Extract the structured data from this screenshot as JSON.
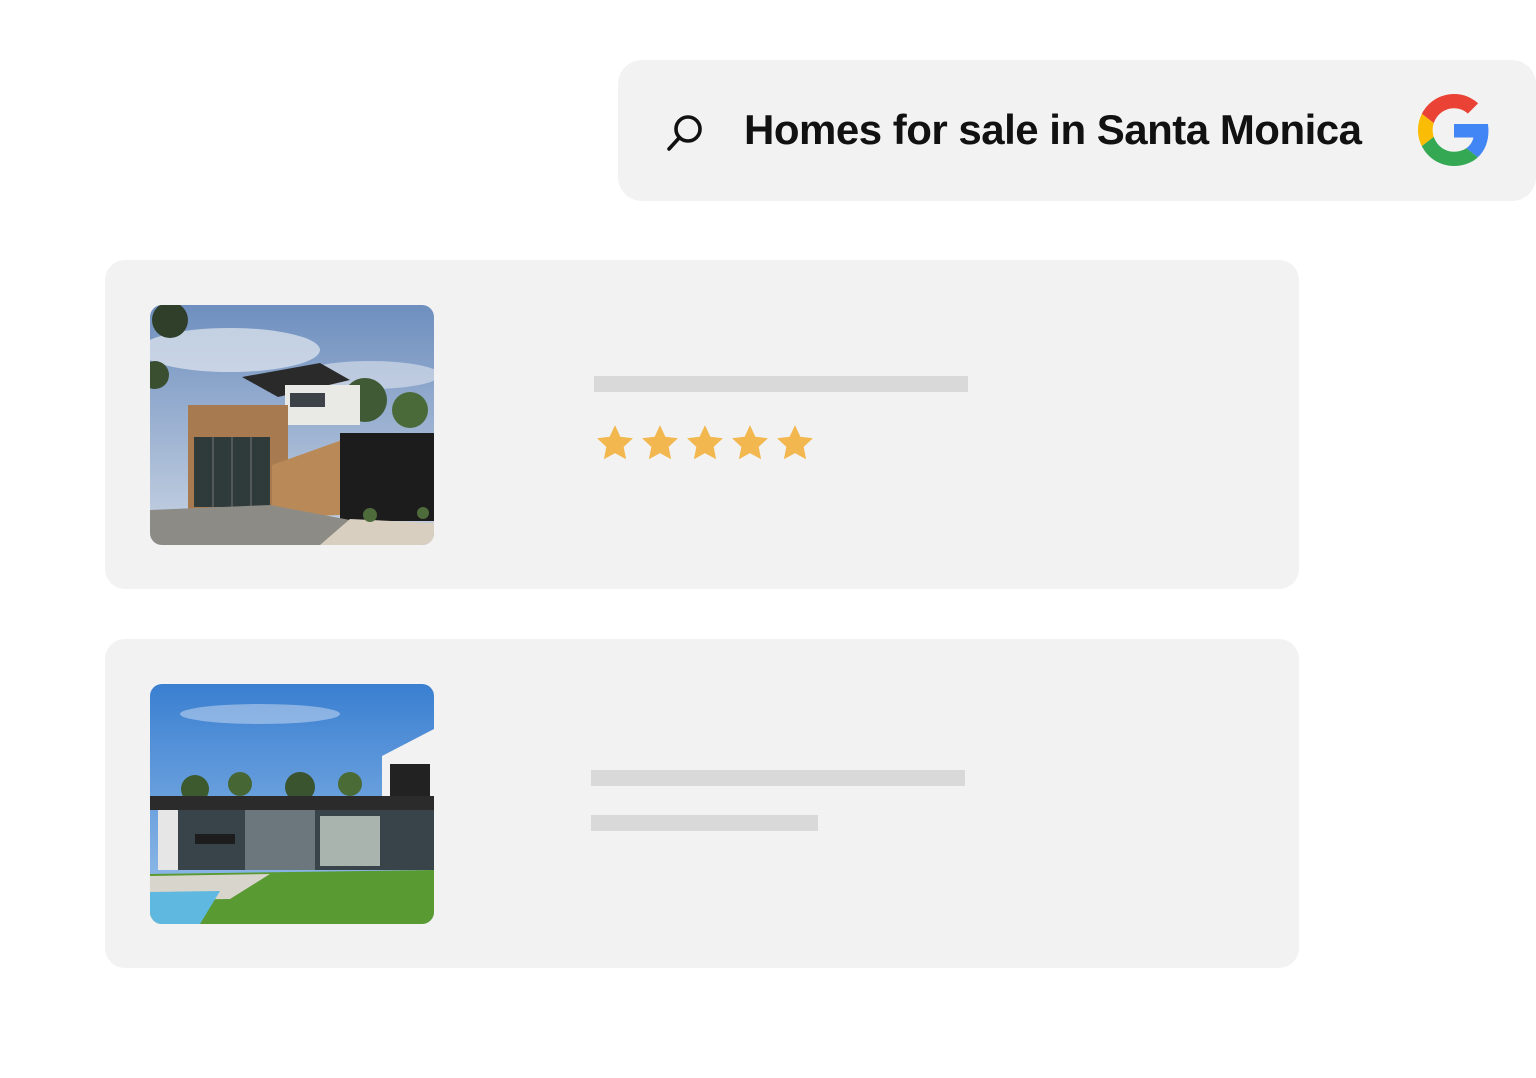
{
  "search": {
    "query": "Homes for sale in Santa Monica",
    "icon": "search-icon",
    "brand_icon": "google-logo"
  },
  "results": [
    {
      "image": "modern-house-timber-facade-photo",
      "rating": 5,
      "rating_max": 5
    },
    {
      "image": "modern-house-pool-lawn-photo"
    }
  ],
  "colors": {
    "card_background": "#f2f2f2",
    "skeleton": "#d9d9d9",
    "star": "#f2b74e",
    "google_blue": "#4285F4",
    "google_red": "#EA4335",
    "google_yellow": "#FBBC05",
    "google_green": "#34A853"
  }
}
